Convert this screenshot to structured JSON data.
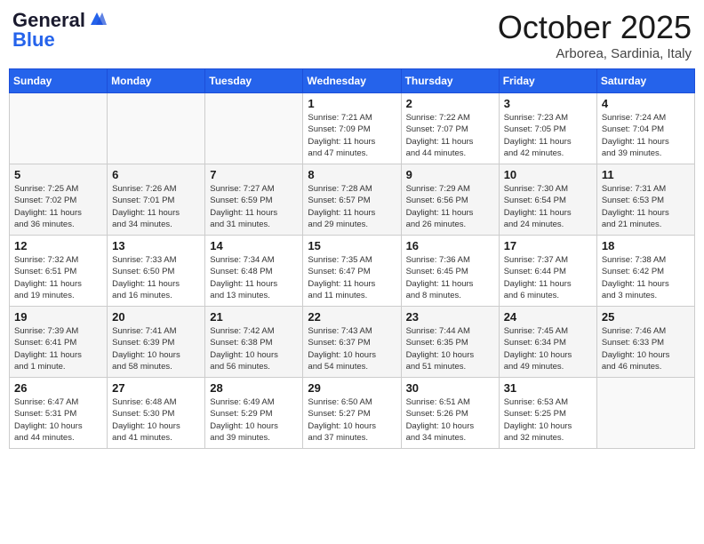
{
  "header": {
    "logo_line1": "General",
    "logo_line2": "Blue",
    "month": "October 2025",
    "location": "Arborea, Sardinia, Italy"
  },
  "days_of_week": [
    "Sunday",
    "Monday",
    "Tuesday",
    "Wednesday",
    "Thursday",
    "Friday",
    "Saturday"
  ],
  "weeks": [
    [
      {
        "day": "",
        "info": ""
      },
      {
        "day": "",
        "info": ""
      },
      {
        "day": "",
        "info": ""
      },
      {
        "day": "1",
        "info": "Sunrise: 7:21 AM\nSunset: 7:09 PM\nDaylight: 11 hours\nand 47 minutes."
      },
      {
        "day": "2",
        "info": "Sunrise: 7:22 AM\nSunset: 7:07 PM\nDaylight: 11 hours\nand 44 minutes."
      },
      {
        "day": "3",
        "info": "Sunrise: 7:23 AM\nSunset: 7:05 PM\nDaylight: 11 hours\nand 42 minutes."
      },
      {
        "day": "4",
        "info": "Sunrise: 7:24 AM\nSunset: 7:04 PM\nDaylight: 11 hours\nand 39 minutes."
      }
    ],
    [
      {
        "day": "5",
        "info": "Sunrise: 7:25 AM\nSunset: 7:02 PM\nDaylight: 11 hours\nand 36 minutes."
      },
      {
        "day": "6",
        "info": "Sunrise: 7:26 AM\nSunset: 7:01 PM\nDaylight: 11 hours\nand 34 minutes."
      },
      {
        "day": "7",
        "info": "Sunrise: 7:27 AM\nSunset: 6:59 PM\nDaylight: 11 hours\nand 31 minutes."
      },
      {
        "day": "8",
        "info": "Sunrise: 7:28 AM\nSunset: 6:57 PM\nDaylight: 11 hours\nand 29 minutes."
      },
      {
        "day": "9",
        "info": "Sunrise: 7:29 AM\nSunset: 6:56 PM\nDaylight: 11 hours\nand 26 minutes."
      },
      {
        "day": "10",
        "info": "Sunrise: 7:30 AM\nSunset: 6:54 PM\nDaylight: 11 hours\nand 24 minutes."
      },
      {
        "day": "11",
        "info": "Sunrise: 7:31 AM\nSunset: 6:53 PM\nDaylight: 11 hours\nand 21 minutes."
      }
    ],
    [
      {
        "day": "12",
        "info": "Sunrise: 7:32 AM\nSunset: 6:51 PM\nDaylight: 11 hours\nand 19 minutes."
      },
      {
        "day": "13",
        "info": "Sunrise: 7:33 AM\nSunset: 6:50 PM\nDaylight: 11 hours\nand 16 minutes."
      },
      {
        "day": "14",
        "info": "Sunrise: 7:34 AM\nSunset: 6:48 PM\nDaylight: 11 hours\nand 13 minutes."
      },
      {
        "day": "15",
        "info": "Sunrise: 7:35 AM\nSunset: 6:47 PM\nDaylight: 11 hours\nand 11 minutes."
      },
      {
        "day": "16",
        "info": "Sunrise: 7:36 AM\nSunset: 6:45 PM\nDaylight: 11 hours\nand 8 minutes."
      },
      {
        "day": "17",
        "info": "Sunrise: 7:37 AM\nSunset: 6:44 PM\nDaylight: 11 hours\nand 6 minutes."
      },
      {
        "day": "18",
        "info": "Sunrise: 7:38 AM\nSunset: 6:42 PM\nDaylight: 11 hours\nand 3 minutes."
      }
    ],
    [
      {
        "day": "19",
        "info": "Sunrise: 7:39 AM\nSunset: 6:41 PM\nDaylight: 11 hours\nand 1 minute."
      },
      {
        "day": "20",
        "info": "Sunrise: 7:41 AM\nSunset: 6:39 PM\nDaylight: 10 hours\nand 58 minutes."
      },
      {
        "day": "21",
        "info": "Sunrise: 7:42 AM\nSunset: 6:38 PM\nDaylight: 10 hours\nand 56 minutes."
      },
      {
        "day": "22",
        "info": "Sunrise: 7:43 AM\nSunset: 6:37 PM\nDaylight: 10 hours\nand 54 minutes."
      },
      {
        "day": "23",
        "info": "Sunrise: 7:44 AM\nSunset: 6:35 PM\nDaylight: 10 hours\nand 51 minutes."
      },
      {
        "day": "24",
        "info": "Sunrise: 7:45 AM\nSunset: 6:34 PM\nDaylight: 10 hours\nand 49 minutes."
      },
      {
        "day": "25",
        "info": "Sunrise: 7:46 AM\nSunset: 6:33 PM\nDaylight: 10 hours\nand 46 minutes."
      }
    ],
    [
      {
        "day": "26",
        "info": "Sunrise: 6:47 AM\nSunset: 5:31 PM\nDaylight: 10 hours\nand 44 minutes."
      },
      {
        "day": "27",
        "info": "Sunrise: 6:48 AM\nSunset: 5:30 PM\nDaylight: 10 hours\nand 41 minutes."
      },
      {
        "day": "28",
        "info": "Sunrise: 6:49 AM\nSunset: 5:29 PM\nDaylight: 10 hours\nand 39 minutes."
      },
      {
        "day": "29",
        "info": "Sunrise: 6:50 AM\nSunset: 5:27 PM\nDaylight: 10 hours\nand 37 minutes."
      },
      {
        "day": "30",
        "info": "Sunrise: 6:51 AM\nSunset: 5:26 PM\nDaylight: 10 hours\nand 34 minutes."
      },
      {
        "day": "31",
        "info": "Sunrise: 6:53 AM\nSunset: 5:25 PM\nDaylight: 10 hours\nand 32 minutes."
      },
      {
        "day": "",
        "info": ""
      }
    ]
  ]
}
